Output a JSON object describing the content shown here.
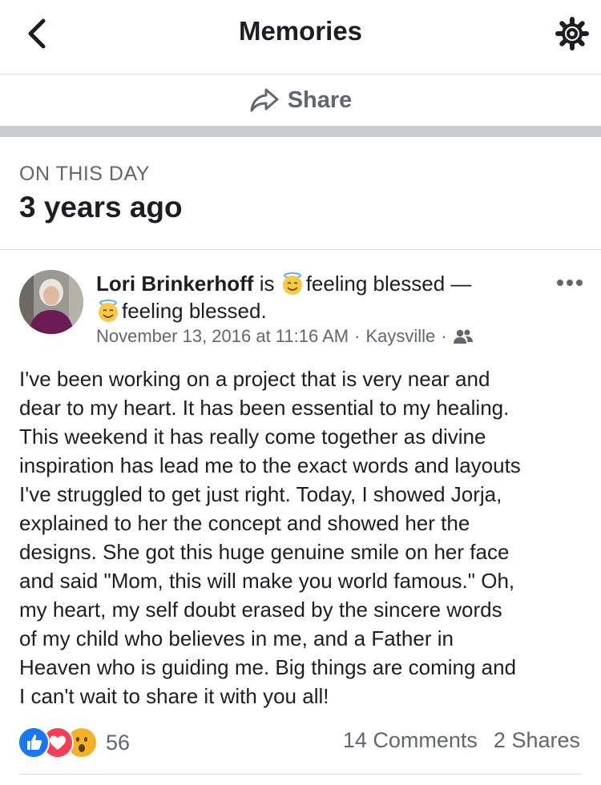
{
  "header": {
    "title": "Memories",
    "back_icon": "chevron-left-icon",
    "settings_icon": "gear-icon"
  },
  "share_bar": {
    "label": "Share",
    "icon": "share-arrow-icon"
  },
  "section": {
    "kicker": "ON THIS DAY",
    "heading": "3 years ago"
  },
  "post": {
    "author": "Lori Brinkerhoff",
    "is_text": "is",
    "feeling_1": "feeling blessed —",
    "feeling_2": "feeling blessed.",
    "timestamp": "November 13, 2016 at 11:16 AM",
    "location": "Kaysville",
    "audience_icon": "friends-icon",
    "body": "I've been working on a project that is very near and\ndear to my heart.  It has been essential to my healing.\nThis weekend it has really come together as divine\ninspiration has lead me to the exact words and layouts\nI've struggled to get just right.  Today, I showed Jorja,\nexplained to her the concept and showed her the\ndesigns.   She got this huge genuine smile on her face\nand said \"Mom, this will make you world famous.\"  Oh,\nmy heart, my self doubt erased by the sincere words\nof my child who believes in me, and a Father in\nHeaven who is guiding me.  Big things are coming and\nI can't wait to share it with you all!",
    "reaction_count": "56",
    "comments": "14 Comments",
    "shares": "2 Shares"
  },
  "colors": {
    "like": "#1877f2",
    "love": "#f33e58",
    "wow": "#f7b125",
    "separator": "#c9ccd1",
    "meta": "#606770"
  }
}
